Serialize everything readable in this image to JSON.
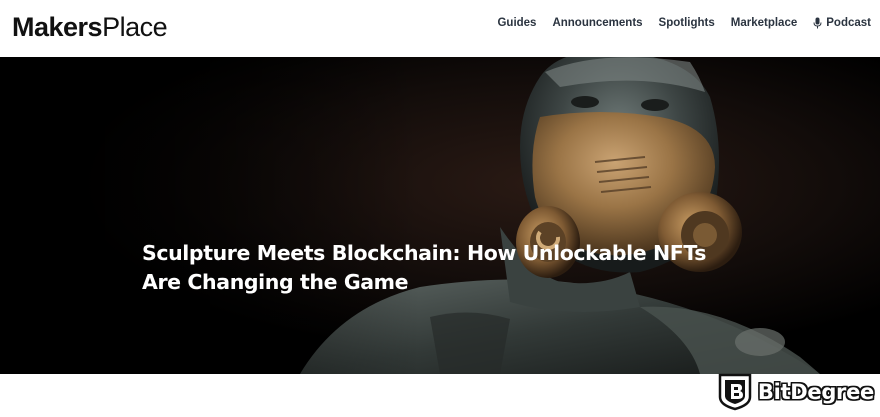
{
  "header": {
    "logo_bold": "Makers",
    "logo_light": "Place",
    "nav": [
      {
        "label": "Guides",
        "icon": null
      },
      {
        "label": "Announcements",
        "icon": null
      },
      {
        "label": "Spotlights",
        "icon": null
      },
      {
        "label": "Marketplace",
        "icon": null
      },
      {
        "label": "Podcast",
        "icon": "microphone-icon"
      }
    ]
  },
  "hero": {
    "title_line1": "Sculpture Meets Blockchain: How Unlockable NFTs",
    "title_line2": "Are Changing the Game",
    "image": "sculpture-gas-mask-bust"
  },
  "watermark": {
    "text": "BitDegree",
    "icon": "bitdegree-shield-icon"
  },
  "colors": {
    "nav_text": "#2b3440",
    "hero_bg": "#000000",
    "bronze": "#8a6a3a"
  }
}
